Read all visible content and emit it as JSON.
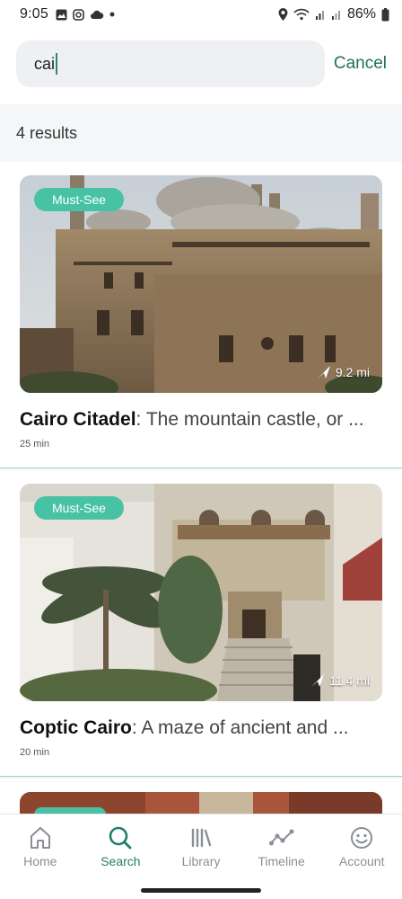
{
  "status_bar": {
    "time": "9:05",
    "battery": "86%",
    "sim1": "Vo))\nLTE1",
    "sim2": "Vo))\nLTE2"
  },
  "search": {
    "value": "cai",
    "cancel_label": "Cancel"
  },
  "results": {
    "count_label": "4 results",
    "items": [
      {
        "badge": "Must-See",
        "distance": "9.2 mi",
        "name": "Cairo Citadel",
        "description": ": The mountain castle, or ...",
        "duration": "25 min"
      },
      {
        "badge": "Must-See",
        "distance": "11.4 mi",
        "name": "Coptic Cairo",
        "description": ": A maze of ancient and ...",
        "duration": "20 min"
      }
    ]
  },
  "nav": {
    "items": [
      {
        "label": "Home",
        "icon": "home-icon"
      },
      {
        "label": "Search",
        "icon": "search-icon"
      },
      {
        "label": "Library",
        "icon": "library-icon"
      },
      {
        "label": "Timeline",
        "icon": "timeline-icon"
      },
      {
        "label": "Account",
        "icon": "account-icon"
      }
    ],
    "active": "Search"
  },
  "colors": {
    "accent": "#1e7f6b",
    "badge": "#47c2a4",
    "divider": "#9fcfc2"
  }
}
